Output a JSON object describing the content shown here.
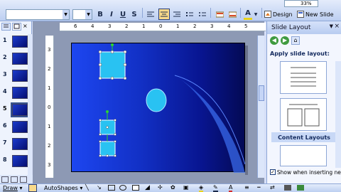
{
  "toolbar": {
    "zoom": "33%",
    "design_label": "Design",
    "new_slide_label": "New Slide",
    "bold": "B",
    "italic": "I",
    "underline": "U",
    "shadow": "S",
    "font_color_icon": "A"
  },
  "ruler": {
    "top_ticks": [
      "6",
      "4",
      "3",
      "2",
      "1",
      "0",
      "1",
      "2",
      "3",
      "4",
      "5"
    ],
    "left_ticks": [
      "3",
      "2",
      "1",
      "0",
      "1",
      "2",
      "3"
    ]
  },
  "slides": [
    {
      "num": "1"
    },
    {
      "num": "2"
    },
    {
      "num": "3"
    },
    {
      "num": "4"
    },
    {
      "num": "5"
    },
    {
      "num": "6"
    },
    {
      "num": "7"
    },
    {
      "num": "8"
    }
  ],
  "selected_slide": "5",
  "task_pane": {
    "title": "Slide Layout",
    "apply_label": "Apply slide layout:",
    "content_layouts_label": "Content Layouts",
    "show_when_inserting": "Show when inserting nev"
  },
  "drawbar": {
    "draw_label": "Draw",
    "autoshapes_label": "AutoShapes"
  },
  "colors": {
    "shape_fill": "#29c2f2",
    "slide_dark": "#040a55",
    "slide_light": "#1d46f0"
  }
}
